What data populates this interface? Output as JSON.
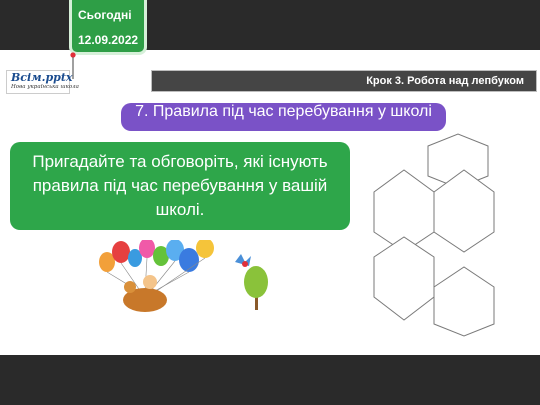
{
  "logo": {
    "name": "Всім.pptx",
    "tagline": "Нова українська школа"
  },
  "date_badge": {
    "today_label": "Сьогодні",
    "date": "12.09.2022"
  },
  "header": {
    "title": "Крок 3. Робота над лепбуком"
  },
  "task": {
    "text": "7. Правила під час перебування у школі"
  },
  "instruction": {
    "text": "Пригадайте та обговоріть, які існують правила під час перебування у вашій школі."
  },
  "colors": {
    "green": "#2ea64a",
    "purple": "#7a52c7",
    "header": "#454545"
  },
  "icons": [
    "pushpin-icon",
    "balloon-kid-illustration",
    "bird-icon",
    "hexagon-shapes"
  ]
}
